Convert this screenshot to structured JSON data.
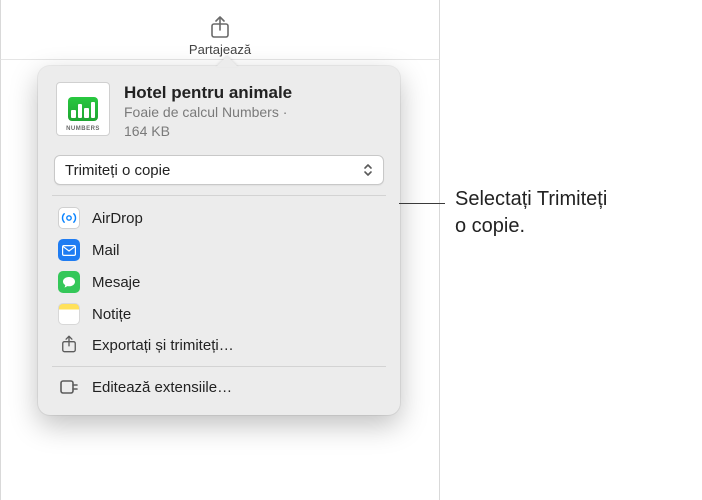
{
  "toolbar": {
    "share_label": "Partajează"
  },
  "doc": {
    "title": "Hotel pentru animale",
    "type_line": "Foaie de calcul Numbers ·",
    "size_line": "164 KB",
    "thumb_tag": "NUMBERS"
  },
  "action_select": {
    "label": "Trimiteți o copie"
  },
  "items": {
    "airdrop": "AirDrop",
    "mail": "Mail",
    "mesaje": "Mesaje",
    "notite": "Notițe",
    "export": "Exportați și trimiteți…",
    "edit_ext": "Editează extensiile…"
  },
  "callout": {
    "line1": "Selectați Trimiteți",
    "line2": "o copie."
  }
}
